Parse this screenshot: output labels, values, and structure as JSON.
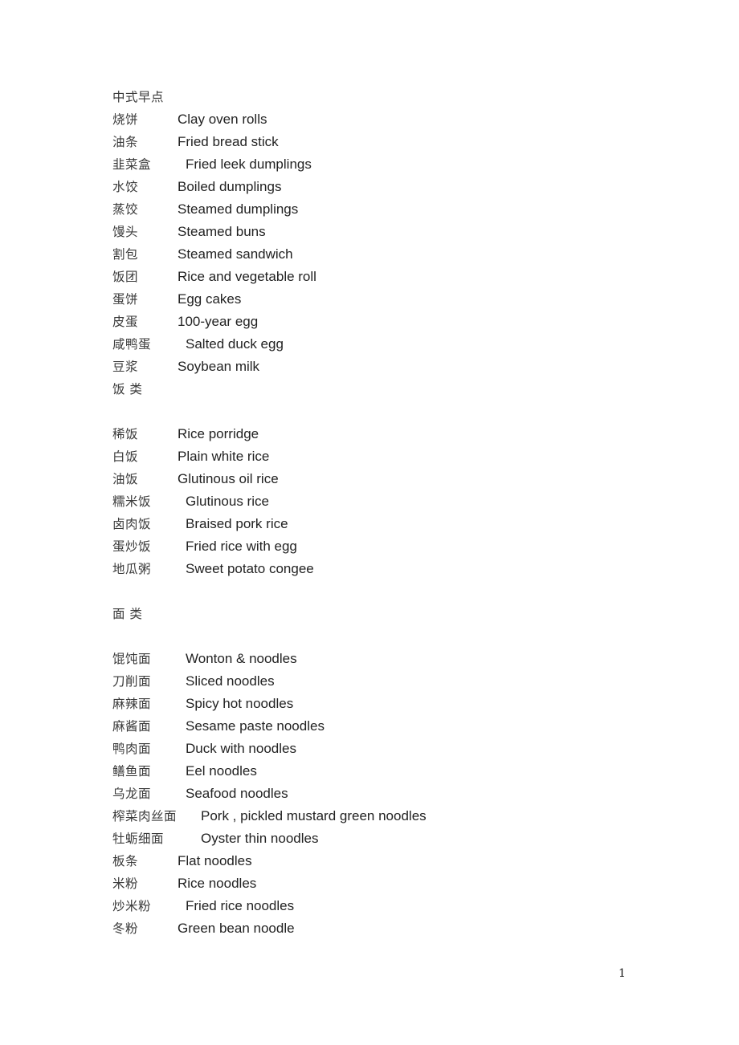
{
  "document": {
    "page_number": "1",
    "blocks": [
      {
        "kind": "heading",
        "text": "中式早点"
      },
      {
        "kind": "entry",
        "tab": "a",
        "zh": "烧饼",
        "en": "Clay oven rolls"
      },
      {
        "kind": "entry",
        "tab": "a",
        "zh": "油条",
        "en": "Fried bread stick"
      },
      {
        "kind": "entry",
        "tab": "b",
        "zh": "韭菜盒",
        "en": "Fried leek dumplings"
      },
      {
        "kind": "entry",
        "tab": "a",
        "zh": "水饺",
        "en": "Boiled dumplings"
      },
      {
        "kind": "entry",
        "tab": "a",
        "zh": "蒸饺",
        "en": "Steamed dumplings"
      },
      {
        "kind": "entry",
        "tab": "a",
        "zh": "馒头",
        "en": "Steamed buns"
      },
      {
        "kind": "entry",
        "tab": "a",
        "zh": "割包",
        "en": "Steamed sandwich"
      },
      {
        "kind": "entry",
        "tab": "a",
        "zh": "饭团",
        "en": "Rice and vegetable roll"
      },
      {
        "kind": "entry",
        "tab": "a",
        "zh": "蛋饼",
        "en": "Egg cakes"
      },
      {
        "kind": "entry",
        "tab": "a",
        "zh": "皮蛋",
        "en": "100-year egg"
      },
      {
        "kind": "entry",
        "tab": "b",
        "zh": "咸鸭蛋",
        "en": "Salted duck egg"
      },
      {
        "kind": "entry",
        "tab": "a",
        "zh": "豆浆",
        "en": "Soybean milk"
      },
      {
        "kind": "heading",
        "text": "饭 类"
      },
      {
        "kind": "blank"
      },
      {
        "kind": "entry",
        "tab": "a",
        "zh": "稀饭",
        "en": "Rice porridge"
      },
      {
        "kind": "entry",
        "tab": "a",
        "zh": "白饭",
        "en": "Plain white rice"
      },
      {
        "kind": "entry",
        "tab": "a",
        "zh": "油饭",
        "en": "Glutinous oil rice"
      },
      {
        "kind": "entry",
        "tab": "b",
        "zh": "糯米饭",
        "en": "Glutinous rice"
      },
      {
        "kind": "entry",
        "tab": "b",
        "zh": "卤肉饭",
        "en": "Braised pork rice"
      },
      {
        "kind": "entry",
        "tab": "b",
        "zh": "蛋炒饭",
        "en": "Fried rice with egg"
      },
      {
        "kind": "entry",
        "tab": "b",
        "zh": "地瓜粥",
        "en": "Sweet potato congee"
      },
      {
        "kind": "blank"
      },
      {
        "kind": "heading",
        "text": "面 类"
      },
      {
        "kind": "blank"
      },
      {
        "kind": "entry",
        "tab": "b",
        "zh": "馄饨面",
        "en": "Wonton & noodles"
      },
      {
        "kind": "entry",
        "tab": "b",
        "zh": "刀削面",
        "en": "Sliced noodles"
      },
      {
        "kind": "entry",
        "tab": "b",
        "zh": "麻辣面",
        "en": "Spicy hot noodles"
      },
      {
        "kind": "entry",
        "tab": "b",
        "zh": "麻酱面",
        "en": "Sesame paste noodles"
      },
      {
        "kind": "entry",
        "tab": "b",
        "zh": "鸭肉面",
        "en": "Duck with noodles"
      },
      {
        "kind": "entry",
        "tab": "b",
        "zh": "鳝鱼面",
        "en": "Eel noodles"
      },
      {
        "kind": "entry",
        "tab": "b",
        "zh": "乌龙面",
        "en": "Seafood noodles"
      },
      {
        "kind": "entry",
        "tab": "c",
        "zh": "榨菜肉丝面",
        "en": "Pork , pickled mustard green noodles"
      },
      {
        "kind": "entry",
        "tab": "c",
        "zh": "牡蛎细面",
        "en": "Oyster thin noodles"
      },
      {
        "kind": "entry",
        "tab": "a",
        "zh": "板条",
        "en": "Flat noodles"
      },
      {
        "kind": "entry",
        "tab": "a",
        "zh": "米粉",
        "en": "Rice noodles"
      },
      {
        "kind": "entry",
        "tab": "b",
        "zh": "炒米粉",
        "en": "Fried rice noodles"
      },
      {
        "kind": "entry",
        "tab": "a",
        "zh": "冬粉",
        "en": "Green bean noodle"
      }
    ]
  }
}
